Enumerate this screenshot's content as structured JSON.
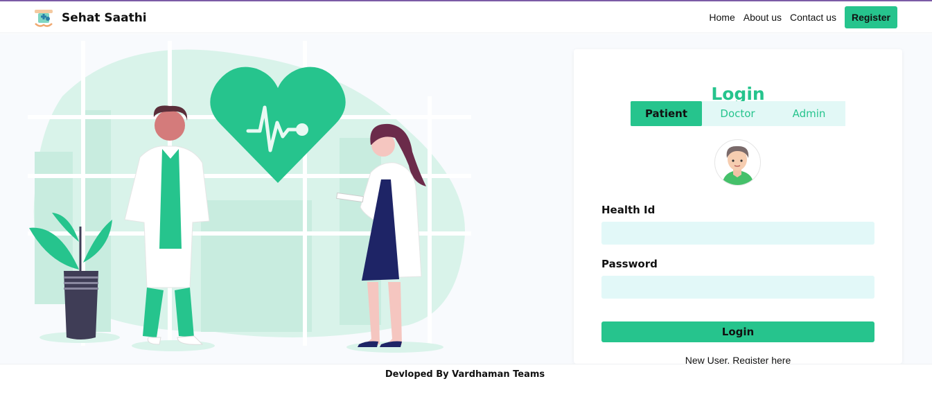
{
  "brand": {
    "name": "Sehat Saathi",
    "logo_icon": "healthcare-logo-icon"
  },
  "nav": {
    "links": [
      "Home",
      "About us",
      "Contact us"
    ],
    "register_label": "Register"
  },
  "login_card": {
    "title": "Login",
    "tabs": [
      {
        "label": "Patient",
        "active": true
      },
      {
        "label": "Doctor",
        "active": false
      },
      {
        "label": "Admin",
        "active": false
      }
    ],
    "avatar_icon": "patient-avatar-icon",
    "health_id_label": "Health Id",
    "health_id_value": "",
    "password_label": "Password",
    "password_value": "",
    "submit_label": "Login",
    "register_link": "New User, Register here"
  },
  "illustration": {
    "icon": "doctors-heartbeat-illustration"
  },
  "footer": {
    "text": "Devloped By Vardhaman Teams"
  },
  "colors": {
    "accent": "#26c48d",
    "input_bg": "#e2f8f8",
    "tab_bg": "#e2f8f6",
    "top_line": "#7b5aa6"
  }
}
